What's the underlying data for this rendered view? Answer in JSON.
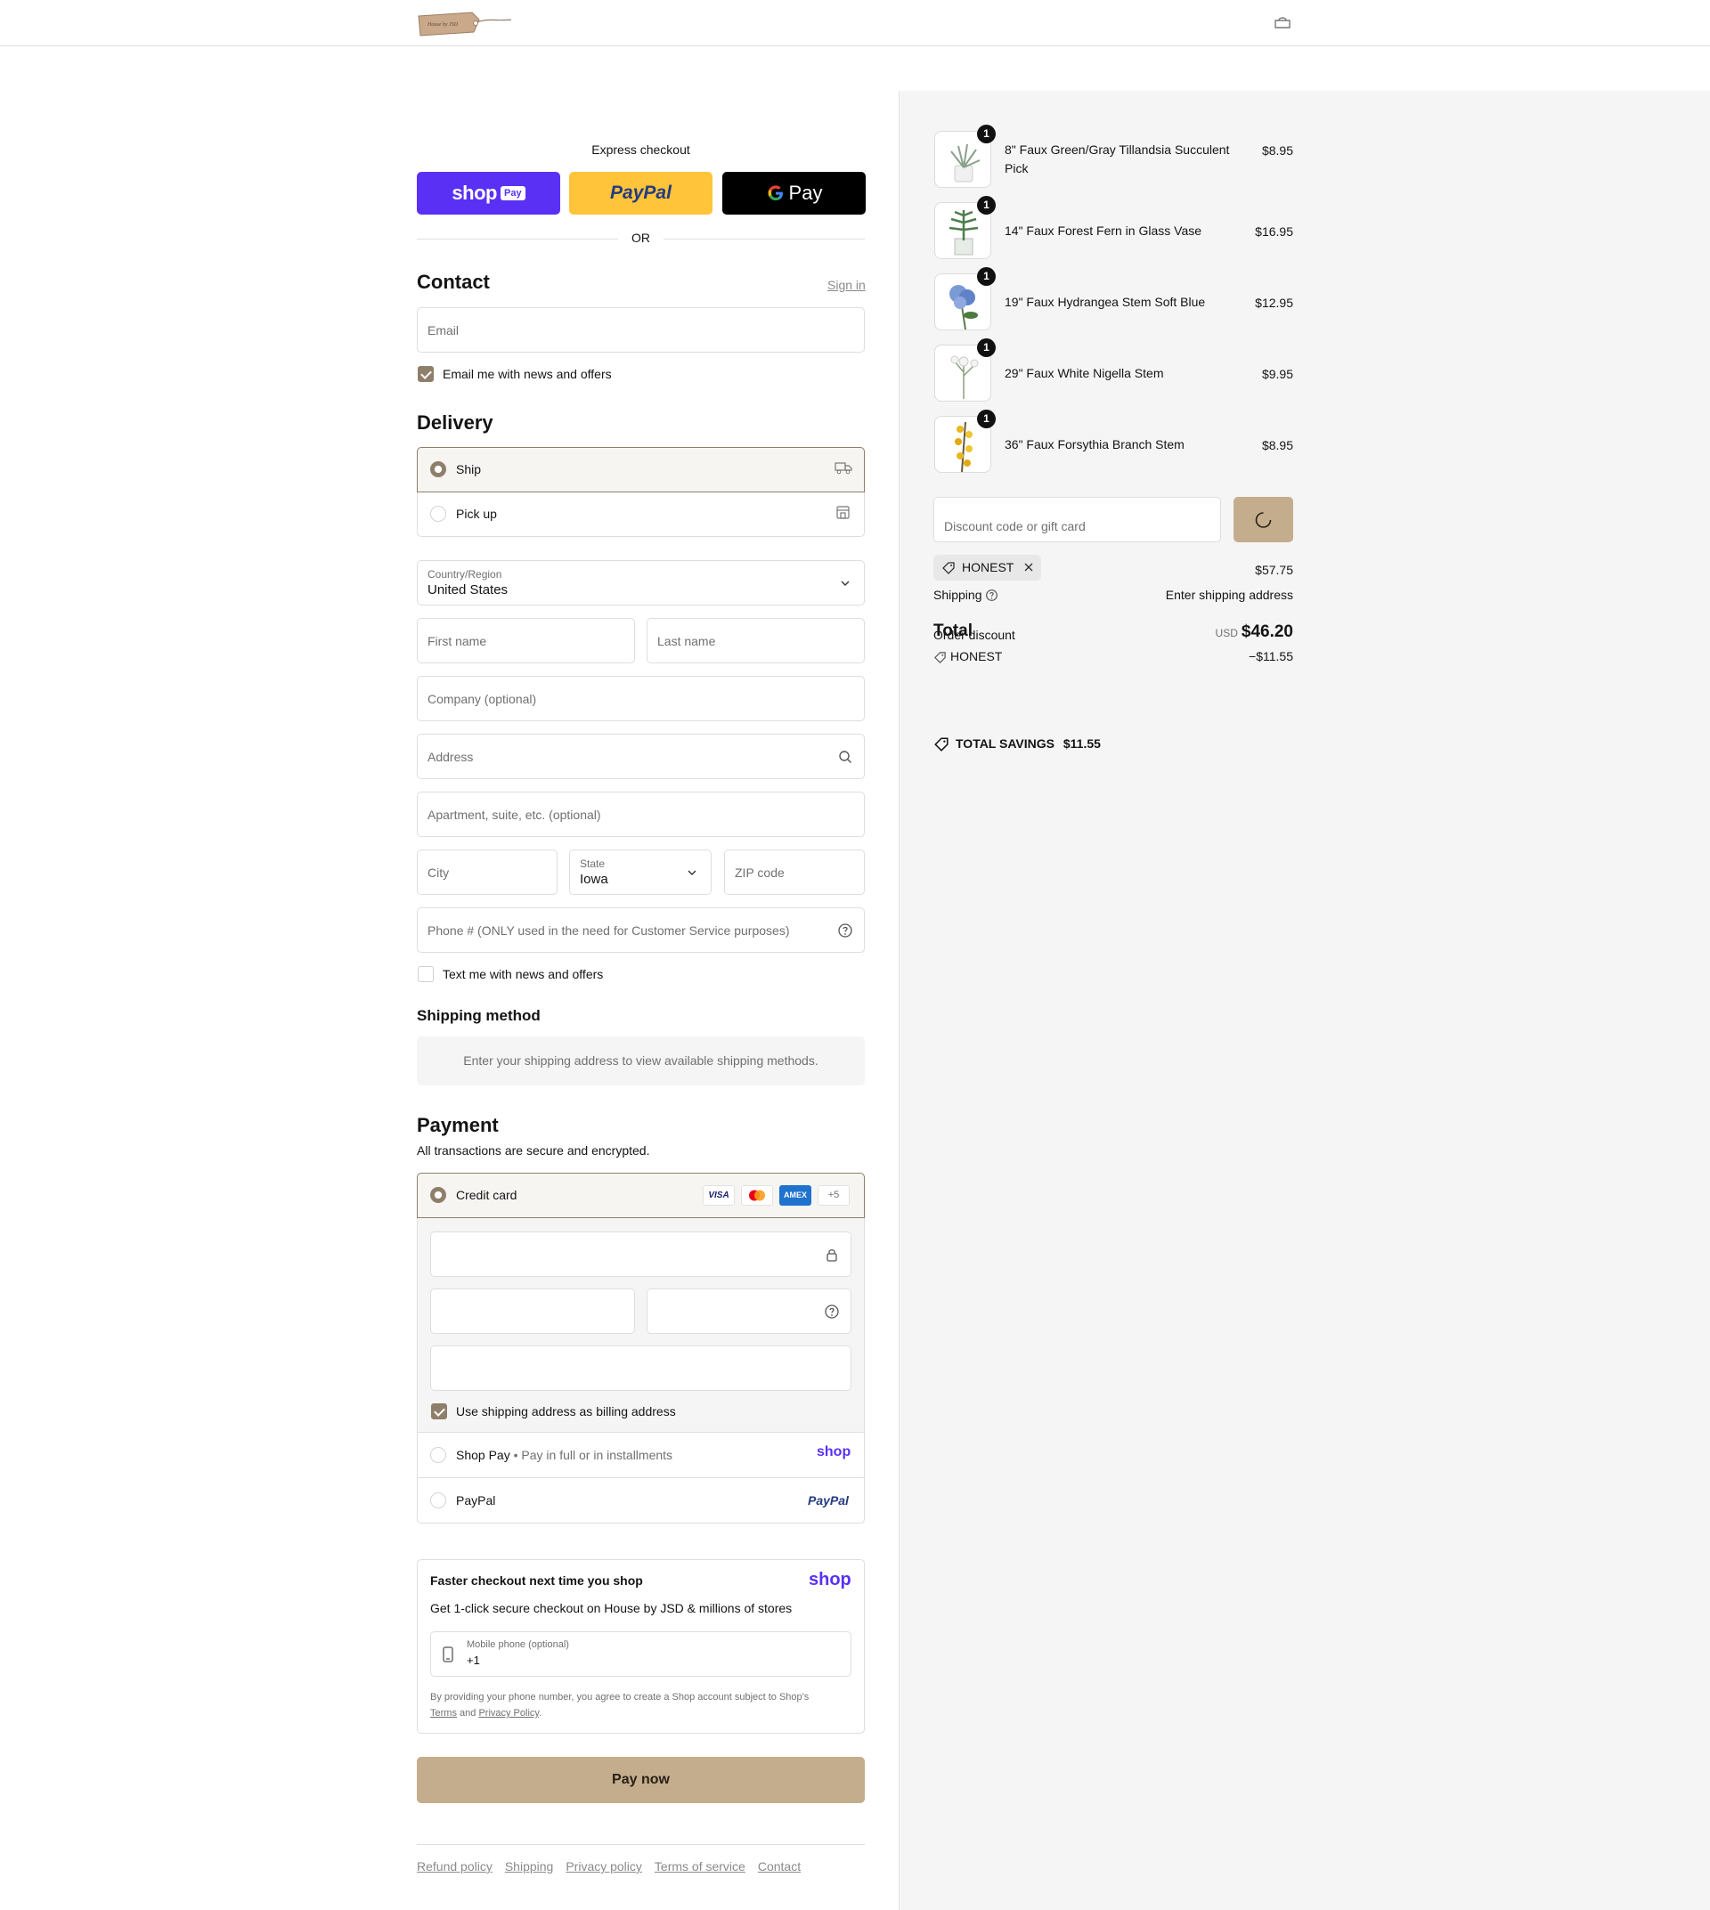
{
  "header": {
    "store_logo_text": "House by JSD",
    "cart_icon": "bag-icon"
  },
  "express": {
    "label": "Express checkout",
    "shop_pay": "shop",
    "shop_pay_badge": "Pay",
    "paypal": "PayPal",
    "gpay": "Pay",
    "or_label": "OR"
  },
  "contact": {
    "title": "Contact",
    "sign_in": "Sign in",
    "email_placeholder": "Email",
    "news_label": "Email me with news and offers",
    "news_checked": true
  },
  "delivery": {
    "title": "Delivery",
    "options": [
      {
        "label": "Ship",
        "selected": true,
        "icon": "truck-icon"
      },
      {
        "label": "Pick up",
        "selected": false,
        "icon": "store-icon"
      }
    ],
    "country_label": "Country/Region",
    "country_value": "United States",
    "first_name": "First name",
    "last_name": "Last name",
    "company": "Company (optional)",
    "address": "Address",
    "apartment": "Apartment, suite, etc. (optional)",
    "city": "City",
    "state_label": "State",
    "state_value": "Iowa",
    "zip": "ZIP code",
    "phone": "Phone # (ONLY used in the need for Customer Service purposes)",
    "text_label": "Text me with news and offers",
    "text_checked": false
  },
  "shipping_method": {
    "title": "Shipping method",
    "notice": "Enter your shipping address to view available shipping methods."
  },
  "payment": {
    "title": "Payment",
    "subtitle": "All transactions are secure and encrypted.",
    "credit_card": "Credit card",
    "card_brands": [
      "VISA",
      "Mastercard",
      "AMEX",
      "+5"
    ],
    "billing_label": "Use shipping address as billing address",
    "billing_checked": true,
    "shop_pay": "Shop Pay",
    "shop_pay_sub": "Pay in full or in installments",
    "shop_logo": "shop",
    "paypal": "PayPal",
    "paypal_logo": "PayPal"
  },
  "shop_promo": {
    "title": "Faster checkout next time you shop",
    "logo": "shop",
    "subtitle": "Get 1-click secure checkout on House by JSD & millions of stores",
    "phone_label": "Mobile phone (optional)",
    "phone_value": "+1",
    "legal_1": "By providing your phone number, you agree to create a Shop account subject to Shop's",
    "legal_terms": "Terms",
    "legal_and": "and",
    "legal_privacy": "Privacy Policy",
    "legal_end": "."
  },
  "pay_now": "Pay now",
  "footer_links": [
    "Refund policy",
    "Shipping",
    "Privacy policy",
    "Terms of service",
    "Contact"
  ],
  "summary": {
    "items": [
      {
        "name": "8\" Faux Green/Gray Tillandsia Succulent Pick",
        "price": "$8.95",
        "qty": "1"
      },
      {
        "name": "14\" Faux Forest Fern in Glass Vase",
        "price": "$16.95",
        "qty": "1"
      },
      {
        "name": "19\" Faux Hydrangea Stem Soft Blue",
        "price": "$12.95",
        "qty": "1"
      },
      {
        "name": "29\" Faux White Nigella Stem",
        "price": "$9.95",
        "qty": "1"
      },
      {
        "name": "36\" Faux Forsythia Branch Stem",
        "price": "$8.95",
        "qty": "1"
      }
    ],
    "discount_placeholder": "Discount code or gift card",
    "applied_code": "HONEST",
    "subtotal_value": "$57.75",
    "shipping_label": "Shipping",
    "shipping_value": "Enter shipping address",
    "total_label": "Total",
    "order_discount_label": "Order discount",
    "total_currency": "USD",
    "total_value": "$46.20",
    "discount_code": "HONEST",
    "discount_value": "−$11.55",
    "savings_label": "TOTAL SAVINGS",
    "savings_value": "$11.55"
  }
}
